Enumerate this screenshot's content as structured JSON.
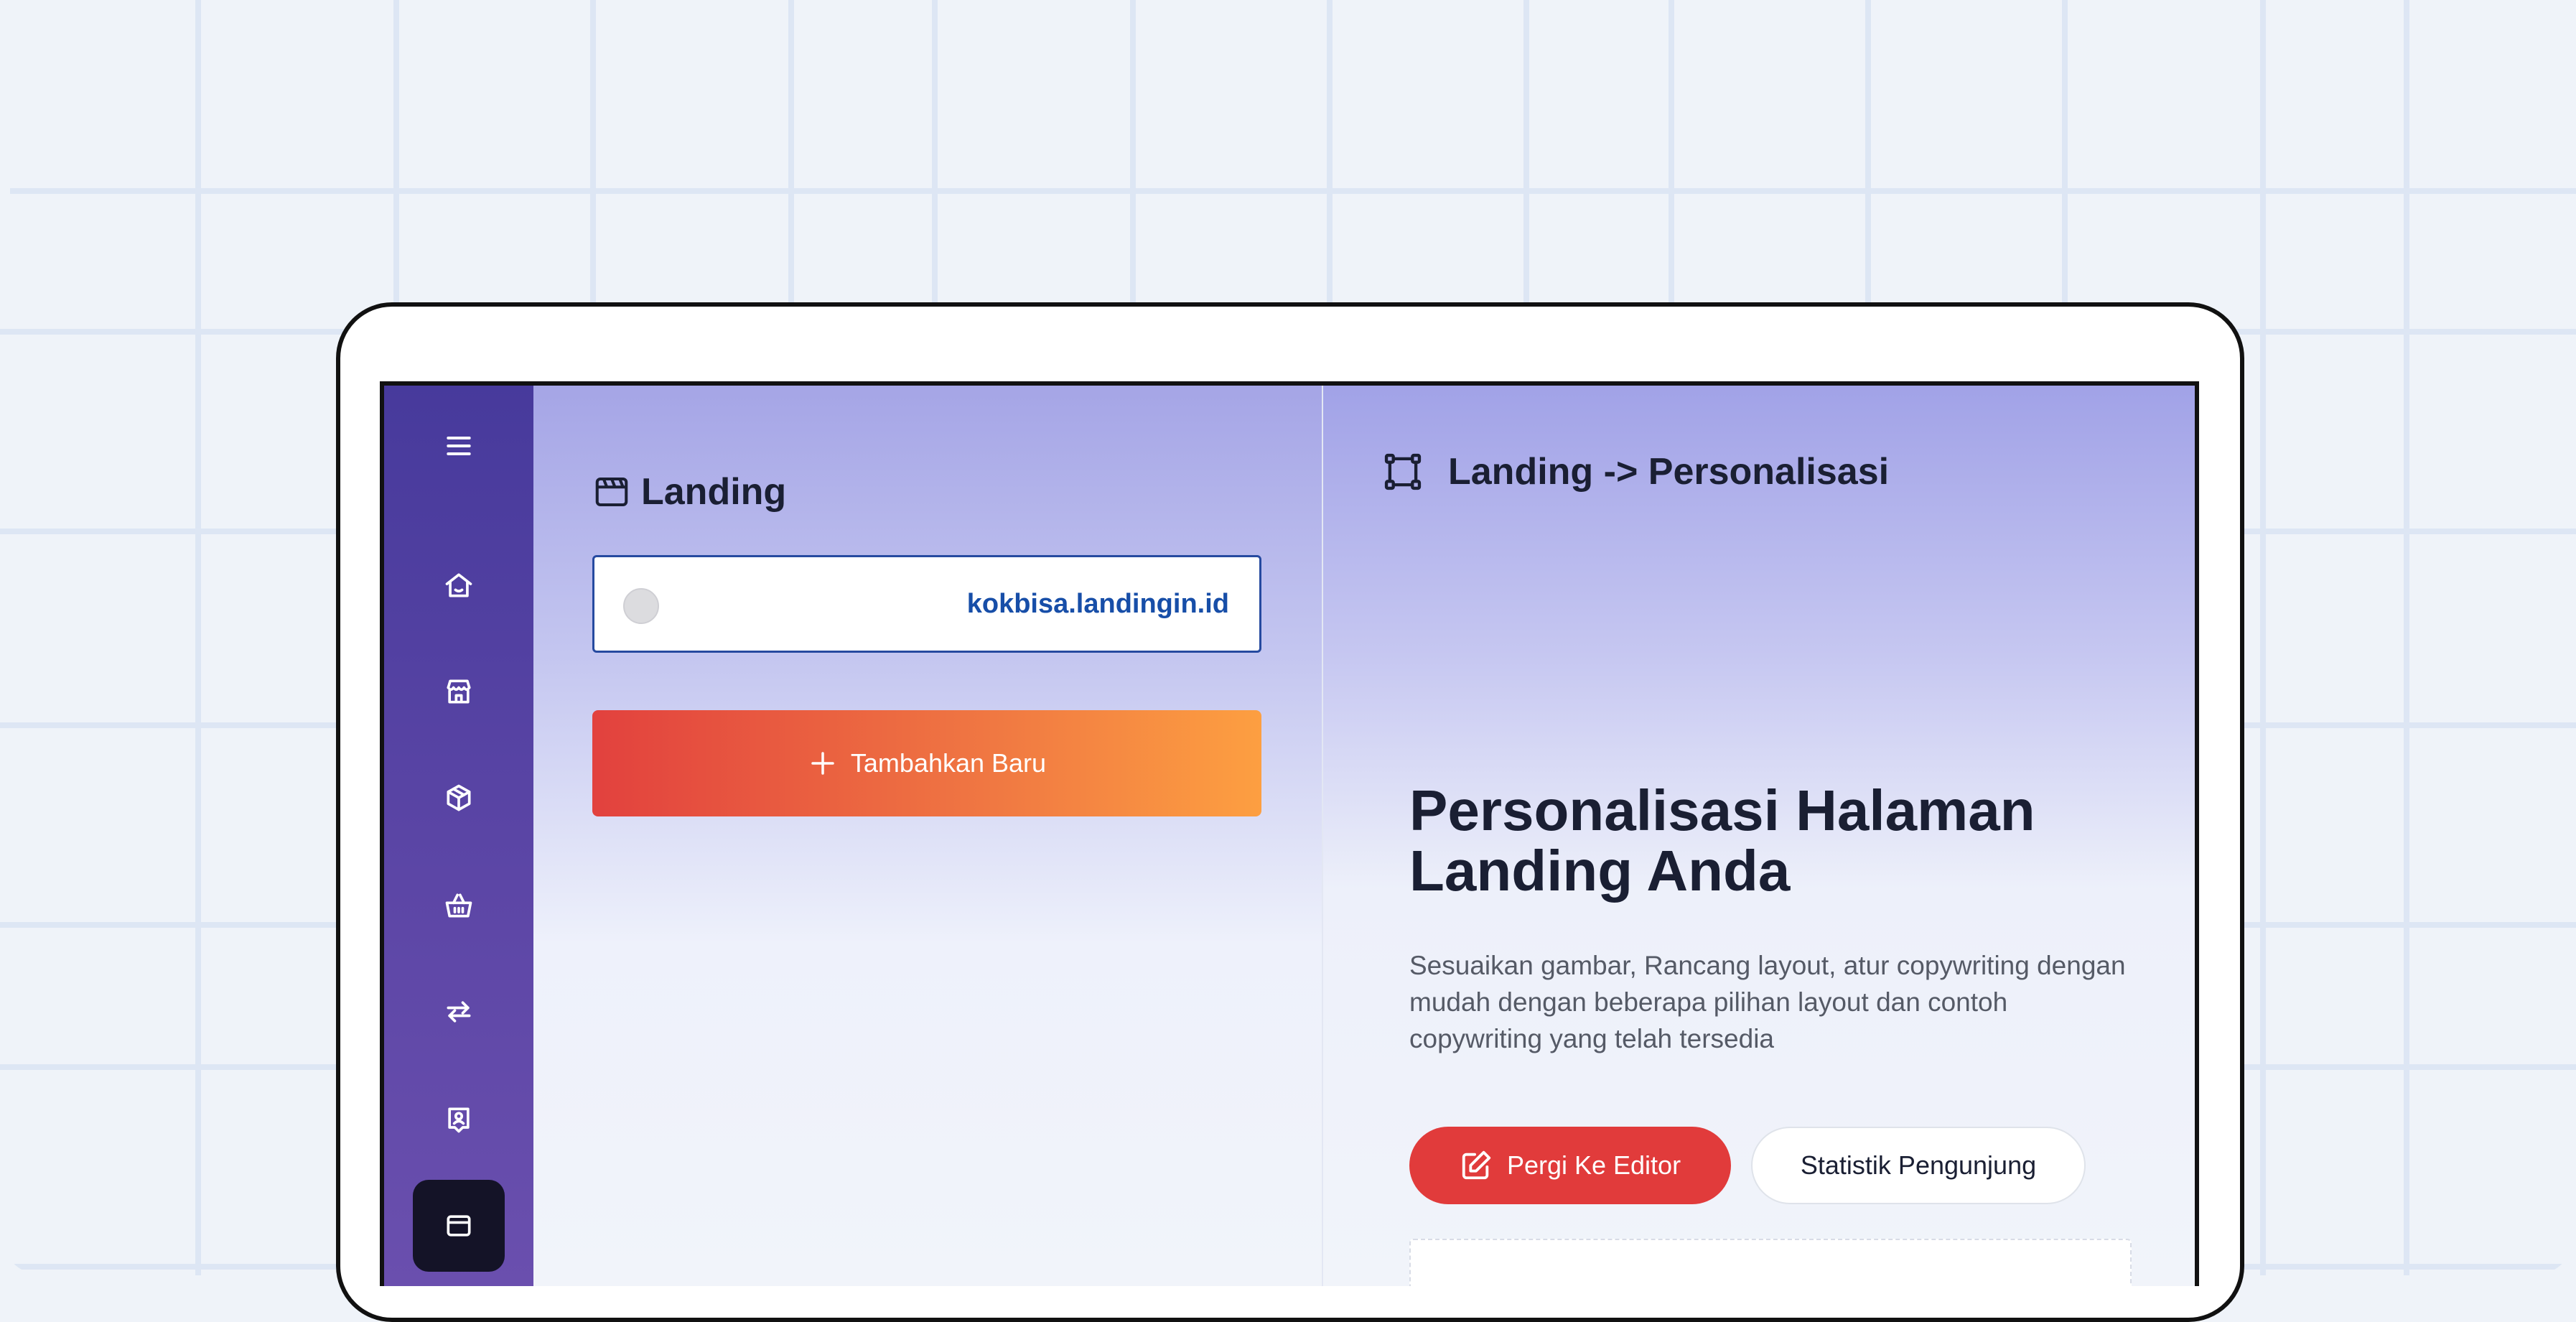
{
  "app": {
    "sidebar": {
      "items": [
        {
          "name": "menu",
          "icon": "menu-icon"
        },
        {
          "name": "home",
          "icon": "home-icon"
        },
        {
          "name": "store",
          "icon": "store-icon"
        },
        {
          "name": "product",
          "icon": "box-icon"
        },
        {
          "name": "basket",
          "icon": "basket-icon"
        },
        {
          "name": "transfer",
          "icon": "transfer-icon"
        },
        {
          "name": "contact",
          "icon": "contact-icon"
        },
        {
          "name": "landing",
          "icon": "browser-window-icon",
          "active": true
        }
      ]
    },
    "left_panel": {
      "title": "Landing",
      "domain": "kokbisa.landingin.id",
      "add_button_label": "Tambahkan Baru"
    },
    "right_panel": {
      "breadcrumb": "Landing -> Personalisasi",
      "heading_line1": "Personalisasi Halaman",
      "heading_line2": "Landing Anda",
      "description": "Sesuaikan gambar, Rancang layout, atur copywriting dengan mudah dengan beberapa pilihan layout dan contoh copywriting yang telah tersedia",
      "primary_button": "Pergi Ke Editor",
      "secondary_button": "Statistik Pengunjung"
    }
  },
  "colors": {
    "sidebar": "#473a9c",
    "accent_red": "#e13b3b",
    "gradient_start": "#e2413e",
    "gradient_end": "#fd9f41",
    "link_blue": "#174ea8"
  }
}
